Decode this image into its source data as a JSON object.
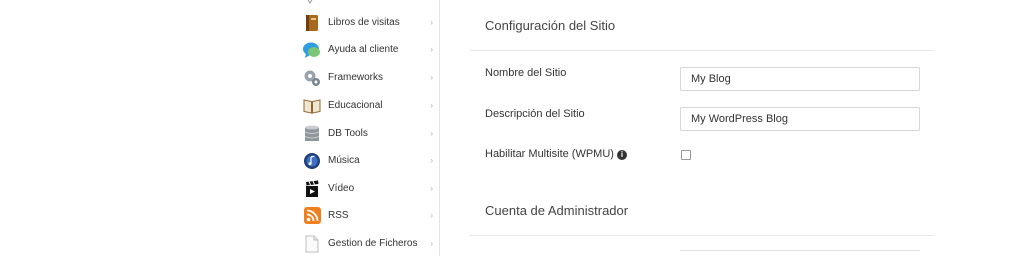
{
  "sidebar": {
    "items": [
      {
        "label": "Libros de visitas",
        "icon": "book-icon"
      },
      {
        "label": "Ayuda al cliente",
        "icon": "chat-bubble-icon"
      },
      {
        "label": "Frameworks",
        "icon": "gears-icon"
      },
      {
        "label": "Educacional",
        "icon": "open-book-icon"
      },
      {
        "label": "DB Tools",
        "icon": "database-icon"
      },
      {
        "label": "Música",
        "icon": "music-disc-icon"
      },
      {
        "label": "Vídeo",
        "icon": "clapperboard-icon"
      },
      {
        "label": "RSS",
        "icon": "rss-icon"
      },
      {
        "label": "Gestion de Ficheros",
        "icon": "file-icon"
      }
    ],
    "chevron": "›"
  },
  "site_config": {
    "title": "Configuración del Sitio",
    "site_name_label": "Nombre del Sitio",
    "site_name_value": "My Blog",
    "site_desc_label": "Descripción del Sitio",
    "site_desc_value": "My WordPress Blog",
    "multisite_label": "Habilitar Multisite (WPMU)",
    "info_glyph": "i"
  },
  "admin": {
    "title": "Cuenta de Administrador"
  }
}
